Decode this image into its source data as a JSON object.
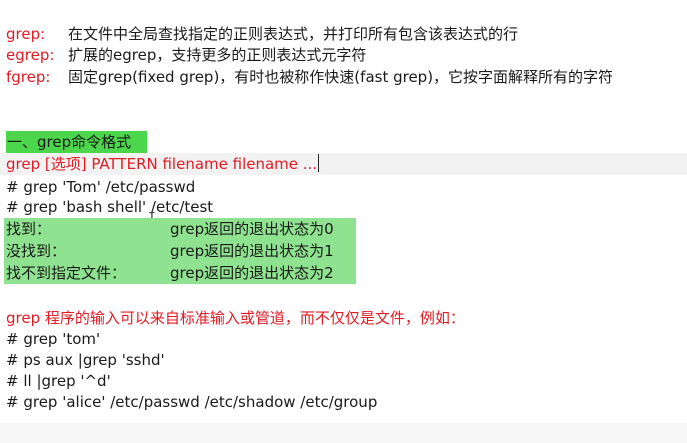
{
  "definitions": [
    {
      "term": "grep:",
      "desc": "在文件中全局查找指定的正则表达式，并打印所有包含该表达式的行"
    },
    {
      "term": "egrep:",
      "desc": "扩展的egrep，支持更多的正则表达式元字符"
    },
    {
      "term": "fgrep:",
      "desc": "固定grep(fixed grep)，有时也被称作快速(fast grep)，它按字面解释所有的字符"
    }
  ],
  "section": {
    "heading": "一、grep命令格式",
    "syntax": "grep [选项] PATTERN filename filename ..."
  },
  "examples1": [
    "# grep 'Tom' /etc/passwd",
    "# grep 'bash shell' /etc/test"
  ],
  "status_rows": [
    {
      "condition": "找到：",
      "result": "grep返回的退出状态为0"
    },
    {
      "condition": "没找到：",
      "result": "grep返回的退出状态为1"
    },
    {
      "condition": "找不到指定文件：",
      "result": "grep返回的退出状态为2"
    }
  ],
  "input_note": "grep 程序的输入可以来自标准输入或管道，而不仅仅是文件，例如：",
  "examples2": [
    "# grep 'tom'",
    "# ps aux |grep 'sshd'",
    "# ll |grep '^d'",
    "# grep 'alice' /etc/passwd /etc/shadow /etc/group"
  ],
  "colors": {
    "term_red": "#e31b23",
    "heading_green": "#4cd64c",
    "status_green": "#8fe28f"
  }
}
